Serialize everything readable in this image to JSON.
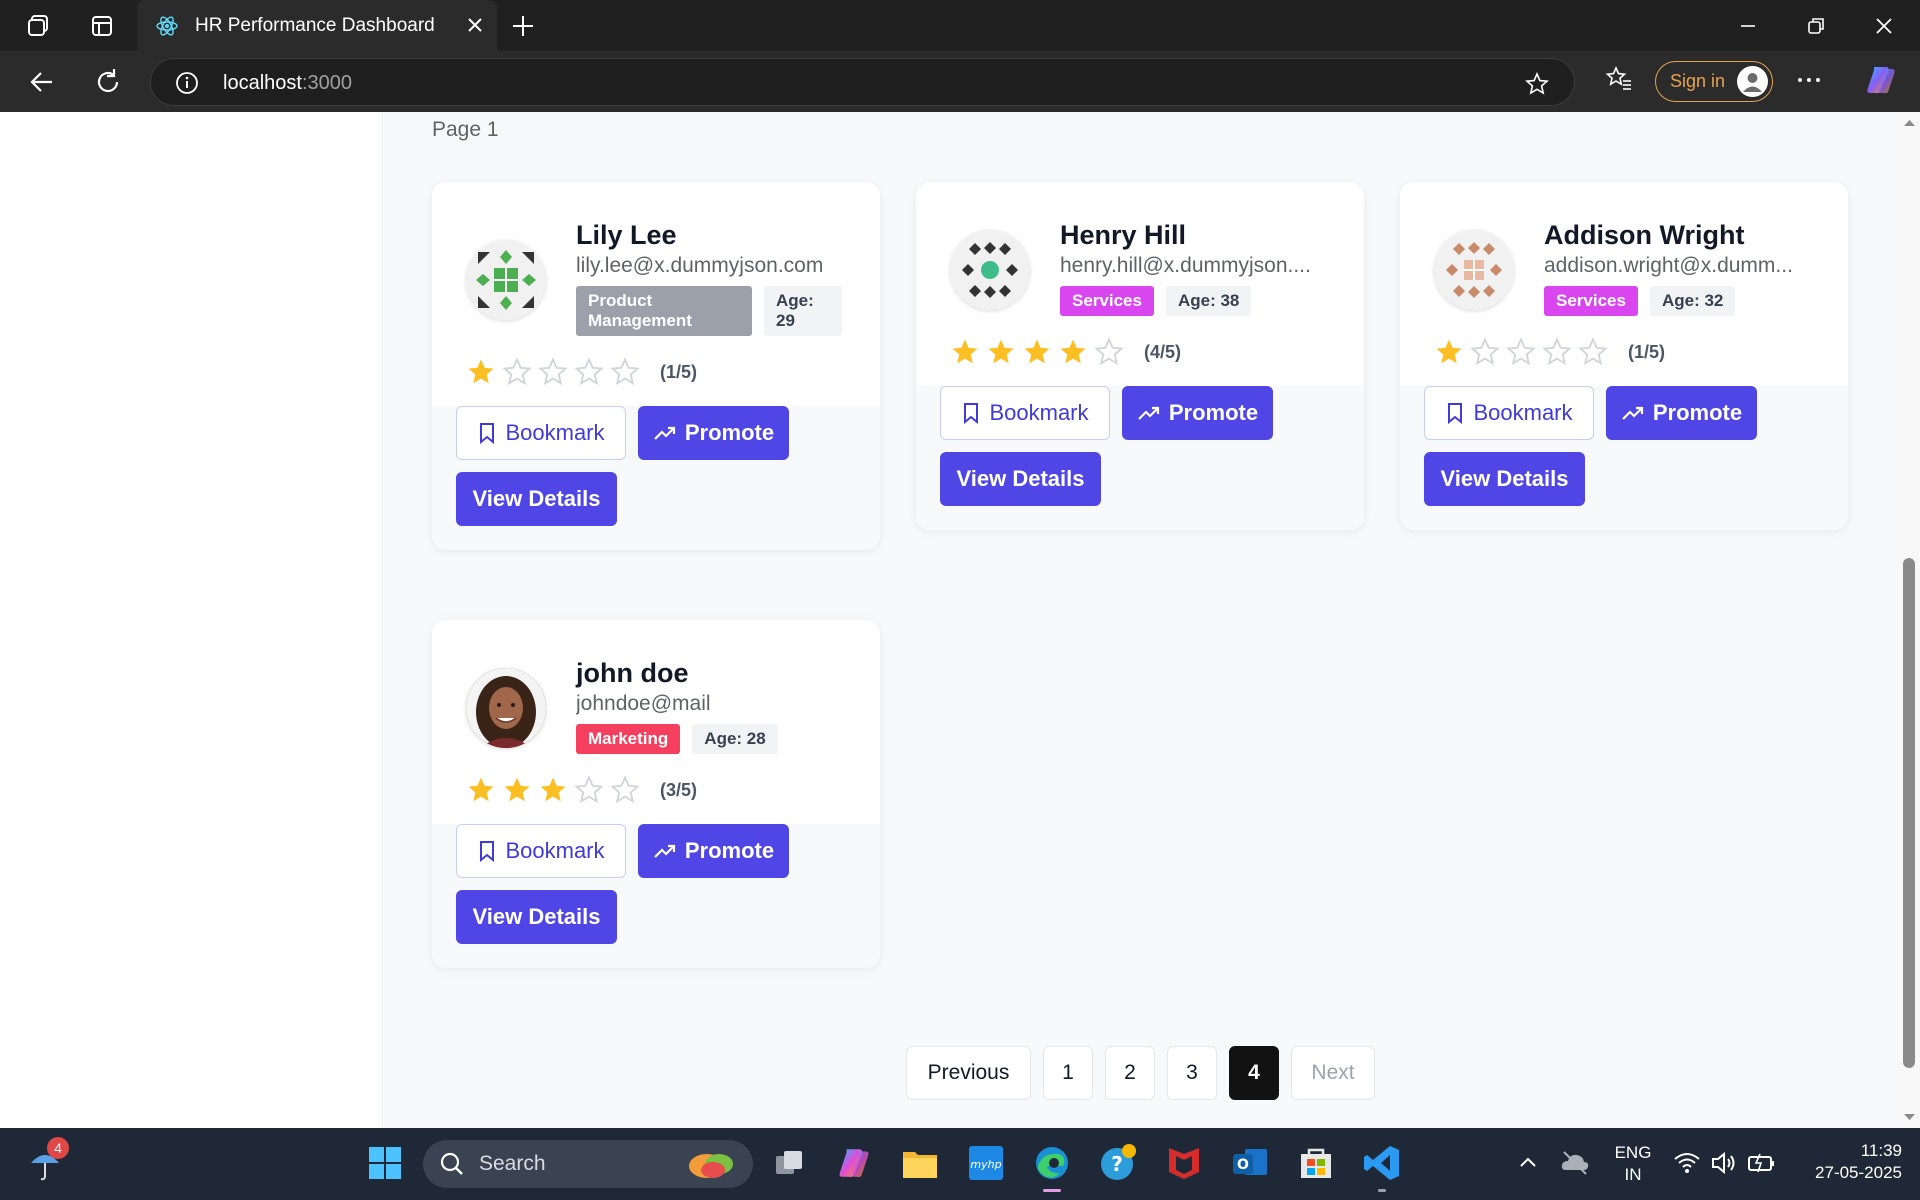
{
  "browser": {
    "tab_title": "HR Performance Dashboard",
    "url_host": "localhost",
    "url_port": ":3000",
    "signin_label": "Sign in"
  },
  "page": {
    "page_label": "Page 1"
  },
  "cards": [
    {
      "name": "Lily Lee",
      "email": "lily.lee@x.dummyjson.com",
      "department": "Product Management",
      "dept_color": "#9ca0ab",
      "age_label": "Age: 29",
      "rating": 1,
      "rating_text": "(1/5)",
      "bookmark_label": "Bookmark",
      "promote_label": "Promote",
      "view_label": "View Details"
    },
    {
      "name": "Henry Hill",
      "email": "henry.hill@x.dummyjson....",
      "department": "Services",
      "dept_color": "#d946ef",
      "age_label": "Age: 38",
      "rating": 4,
      "rating_text": "(4/5)",
      "bookmark_label": "Bookmark",
      "promote_label": "Promote",
      "view_label": "View Details"
    },
    {
      "name": "Addison Wright",
      "email": "addison.wright@x.dumm...",
      "department": "Services",
      "dept_color": "#d946ef",
      "age_label": "Age: 32",
      "rating": 1,
      "rating_text": "(1/5)",
      "bookmark_label": "Bookmark",
      "promote_label": "Promote",
      "view_label": "View Details"
    },
    {
      "name": "john doe",
      "email": "johndoe@mail",
      "department": "Marketing",
      "dept_color": "#f43f5e",
      "age_label": "Age: 28",
      "rating": 3,
      "rating_text": "(3/5)",
      "bookmark_label": "Bookmark",
      "promote_label": "Promote",
      "view_label": "View Details"
    }
  ],
  "pagination": {
    "previous": "Previous",
    "pages": [
      "1",
      "2",
      "3",
      "4"
    ],
    "active_page": "4",
    "next": "Next"
  },
  "taskbar": {
    "search_placeholder": "Search",
    "weather_badge": "4",
    "lang_line1": "ENG",
    "lang_line2": "IN",
    "time": "11:39",
    "date": "27-05-2025"
  },
  "colors": {
    "accent": "#4f46e5",
    "star_filled": "#fbbf24",
    "star_empty": "#d1d5db"
  }
}
